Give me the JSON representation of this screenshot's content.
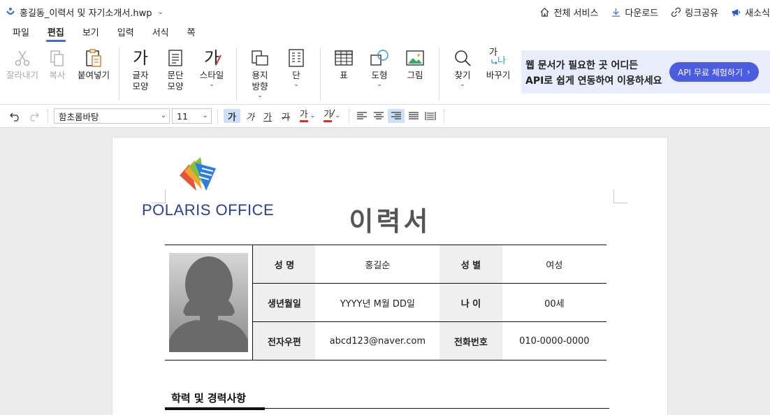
{
  "titlebar": {
    "filename": "홍길동_이력서 및 자기소개서.hwp",
    "all_services": "전체 서비스",
    "download": "다운로드",
    "link_share": "링크공유",
    "new_news": "새소식"
  },
  "menu": {
    "tabs": [
      "파일",
      "편집",
      "보기",
      "입력",
      "서식",
      "쪽"
    ],
    "active": "편집"
  },
  "ribbon": {
    "cut": "잘라내기",
    "copy": "복사",
    "paste": "붙여넣기",
    "char_shape_1": "글자",
    "char_shape_2": "모양",
    "para_shape_1": "문단",
    "para_shape_2": "모양",
    "style": "스타일",
    "paper_dir_1": "용지",
    "paper_dir_2": "방향",
    "column": "단",
    "table": "표",
    "shape": "도형",
    "image": "그림",
    "find": "찾기",
    "replace": "바꾸기",
    "char_icon": "가",
    "replace_icon_top": "가",
    "replace_icon_bottom": "나"
  },
  "ad": {
    "line1": "웹 문서가 필요한 곳 어디든",
    "line2": "API로 쉽게 연동하여 이용하세요",
    "cta": "API 무료 체험하기"
  },
  "format": {
    "font_name": "함초롬바탕",
    "font_size": "11",
    "bold": "가",
    "italic": "가",
    "underline": "가",
    "strike": "가",
    "font_color": "가",
    "highlight": "가"
  },
  "document": {
    "logo_text": "POLARIS OFFICE",
    "title": "이력서",
    "rows": [
      {
        "label1": "성 명",
        "value1": "홍길순",
        "label2": "성 별",
        "value2": "여성"
      },
      {
        "label1": "생년월일",
        "value1": "YYYY년 M월 DD일",
        "label2": "나 이",
        "value2": "00세"
      },
      {
        "label1": "전자우편",
        "value1": "abcd123@naver.com",
        "label2": "전화번호",
        "value2": "010-0000-0000"
      }
    ],
    "section_title": "학력 및 경력사항"
  }
}
